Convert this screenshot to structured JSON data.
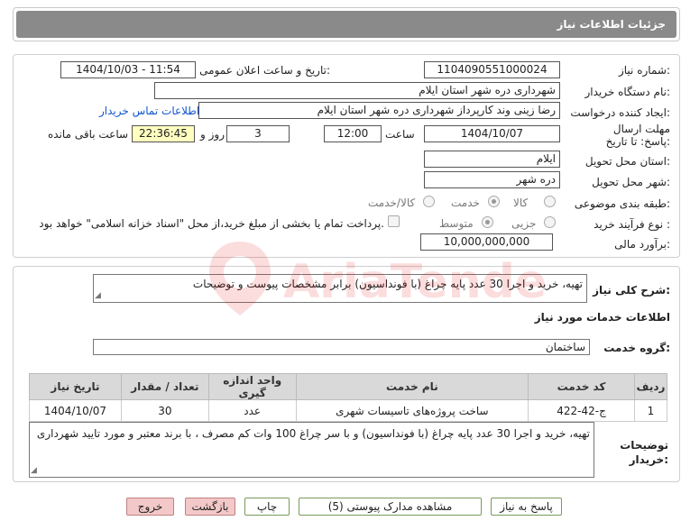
{
  "title": "جزئیات اطلاعات نیاز",
  "fields": {
    "need_number_label": "شماره نیاز:",
    "need_number": "1104090551000024",
    "announce_label": "تاریخ و ساعت اعلان عمومی:",
    "announce_value": "1404/10/03 - 11:54",
    "buyer_label": "نام دستگاه خریدار:",
    "buyer_value": "شهرداری دره شهر استان ایلام",
    "creator_label": "ایجاد کننده درخواست:",
    "creator_value": "رضا زینی وند کارپرداز شهرداری دره شهر استان ایلام",
    "contact_link": "اطلاعات تماس خریدار",
    "deadline_label": "مهلت ارسال پاسخ: تا تاریخ:",
    "deadline_date": "1404/10/07",
    "time_label": "ساعت",
    "deadline_time": "12:00",
    "days_value": "3",
    "days_label": "روز و",
    "remaining_value": "22:36:45",
    "remaining_label": "ساعت باقی مانده",
    "province_label": "استان محل تحویل:",
    "province_value": "ایلام",
    "city_label": "شهر محل تحویل:",
    "city_value": "دره شهر",
    "category_label": "طبقه بندی موضوعی:",
    "category_options": [
      "کالا",
      "خدمت",
      "کالا/خدمت"
    ],
    "process_label": "نوع فرآیند خرید :",
    "process_options": [
      "جزیی",
      "متوسط"
    ],
    "payment_note": "پرداخت تمام یا بخشی از مبلغ خرید،از محل \"اسناد خزانه اسلامی\" خواهد بود.",
    "estimate_label": "برآورد مالی:",
    "estimate_value": "10,000,000,000"
  },
  "desc": {
    "label": "شرح کلی نیاز:",
    "value": "تهیه، خرید و اجرا 30 عدد پایه چراغ (با فونداسیون) برابر مشخصات پیوست و توضیحات",
    "services_title": "اطلاعات خدمات مورد نیاز",
    "group_label": "گروه خدمت:",
    "group_value": "ساختمان"
  },
  "table": {
    "headers": [
      "ردیف",
      "کد خدمت",
      "نام خدمت",
      "واحد اندازه گیری",
      "تعداد / مقدار",
      "تاریخ نیاز"
    ],
    "rows": [
      [
        "1",
        "ج-42-422",
        "ساخت پروژه‌های تاسیسات شهری",
        "عدد",
        "30",
        "1404/10/07"
      ]
    ]
  },
  "notes": {
    "label": "توضیحات خریدار:",
    "value": "تهیه، خرید و اجرا 30 عدد پایه چراغ (با فونداسیون) و با سر چراغ 100 وات کم مصرف ، با برند معتبر و مورد تایید شهرداری"
  },
  "buttons": {
    "reply": "پاسخ به نیاز",
    "attachments": "مشاهده مدارک پیوستی (5)",
    "print": "چاپ",
    "back": "بازگشت",
    "exit": "خروج"
  },
  "watermark": "AriaTender.neT",
  "colors": {
    "header": "#8a8a8a",
    "link": "#1155cc",
    "remaining_bg": "#ffffc0",
    "danger_btn": "#f3c8c8"
  }
}
